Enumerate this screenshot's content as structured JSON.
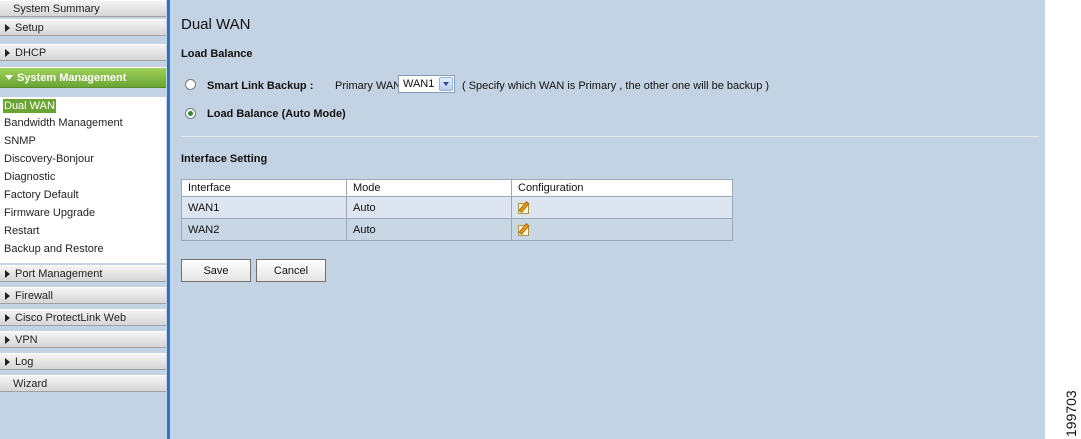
{
  "sidebar": {
    "system_summary": "System Summary",
    "setup": "Setup",
    "dhcp": "DHCP",
    "system_management": "System Management",
    "submenu": [
      "Dual WAN",
      "Bandwidth Management",
      "SNMP",
      "Discovery-Bonjour",
      "Diagnostic",
      "Factory Default",
      "Firmware Upgrade",
      "Restart",
      "Backup and Restore"
    ],
    "port_management": "Port Management",
    "firewall": "Firewall",
    "protectlink": "Cisco ProtectLink Web",
    "vpn": "VPN",
    "log": "Log",
    "wizard": "Wizard"
  },
  "main": {
    "title": "Dual WAN",
    "load_balance_heading": "Load Balance",
    "smart_link_label": "Smart Link Backup :",
    "primary_wan_label": "Primary WAN",
    "primary_wan_value": "WAN1",
    "smart_link_hint": "( Specify which WAN is Primary , the other one will be backup )",
    "load_balance_label": "Load Balance (Auto Mode)",
    "selected_mode": "Load Balance (Auto Mode)",
    "interface_heading": "Interface Setting",
    "table": {
      "headers": [
        "Interface",
        "Mode",
        "Configuration"
      ],
      "rows": [
        {
          "interface": "WAN1",
          "mode": "Auto"
        },
        {
          "interface": "WAN2",
          "mode": "Auto"
        }
      ]
    },
    "save_label": "Save",
    "cancel_label": "Cancel"
  },
  "figure_id": "199703",
  "colors": {
    "content_bg": "#c4d3e3",
    "active_nav": "#6aa534",
    "sidebar_rule": "#3b6fb0"
  },
  "icons": [
    "arrow-right-icon",
    "arrow-down-icon",
    "dropdown-arrow-icon",
    "edit-icon"
  ]
}
